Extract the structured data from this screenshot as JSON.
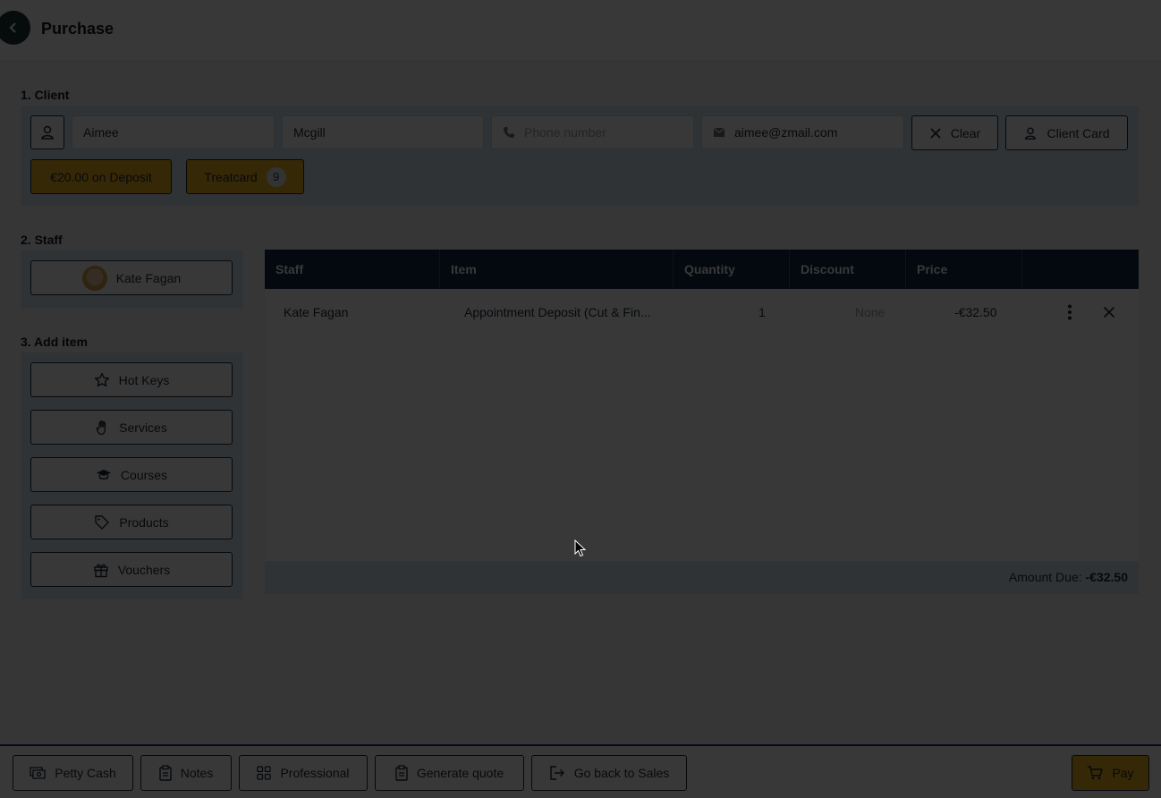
{
  "header": {
    "title": "Purchase"
  },
  "client": {
    "section_label": "1. Client",
    "first_name": "Aimee",
    "last_name": "Mcgill",
    "phone_placeholder": "Phone number",
    "email": "aimee@zmail.com",
    "clear_label": "Clear",
    "client_card_label": "Client Card",
    "deposit_label": "€20.00 on Deposit",
    "treatcard_label": "Treatcard",
    "treatcard_count": "9"
  },
  "staff": {
    "section_label": "2. Staff",
    "selected_name": "Kate Fagan"
  },
  "add_item": {
    "section_label": "3. Add item",
    "buttons": [
      "Hot Keys",
      "Services",
      "Courses",
      "Products",
      "Vouchers"
    ]
  },
  "table": {
    "headers": [
      "Staff",
      "Item",
      "Quantity",
      "Discount",
      "Price"
    ],
    "rows": [
      {
        "staff": "Kate Fagan",
        "item": "Appointment Deposit (Cut & Fin...",
        "quantity": "1",
        "discount": "None",
        "price": "-€32.50"
      }
    ],
    "amount_due_label": "Amount Due:",
    "amount_due_value": "-€32.50"
  },
  "footer": {
    "petty_cash": "Petty Cash",
    "notes": "Notes",
    "professional": "Professional",
    "generate_quote": "Generate quote",
    "go_back": "Go back to Sales",
    "pay": "Pay"
  },
  "colors": {
    "accent_yellow": "#f2b51d",
    "header_navy": "#0f2943",
    "panel_blue": "#dbe6f6"
  }
}
